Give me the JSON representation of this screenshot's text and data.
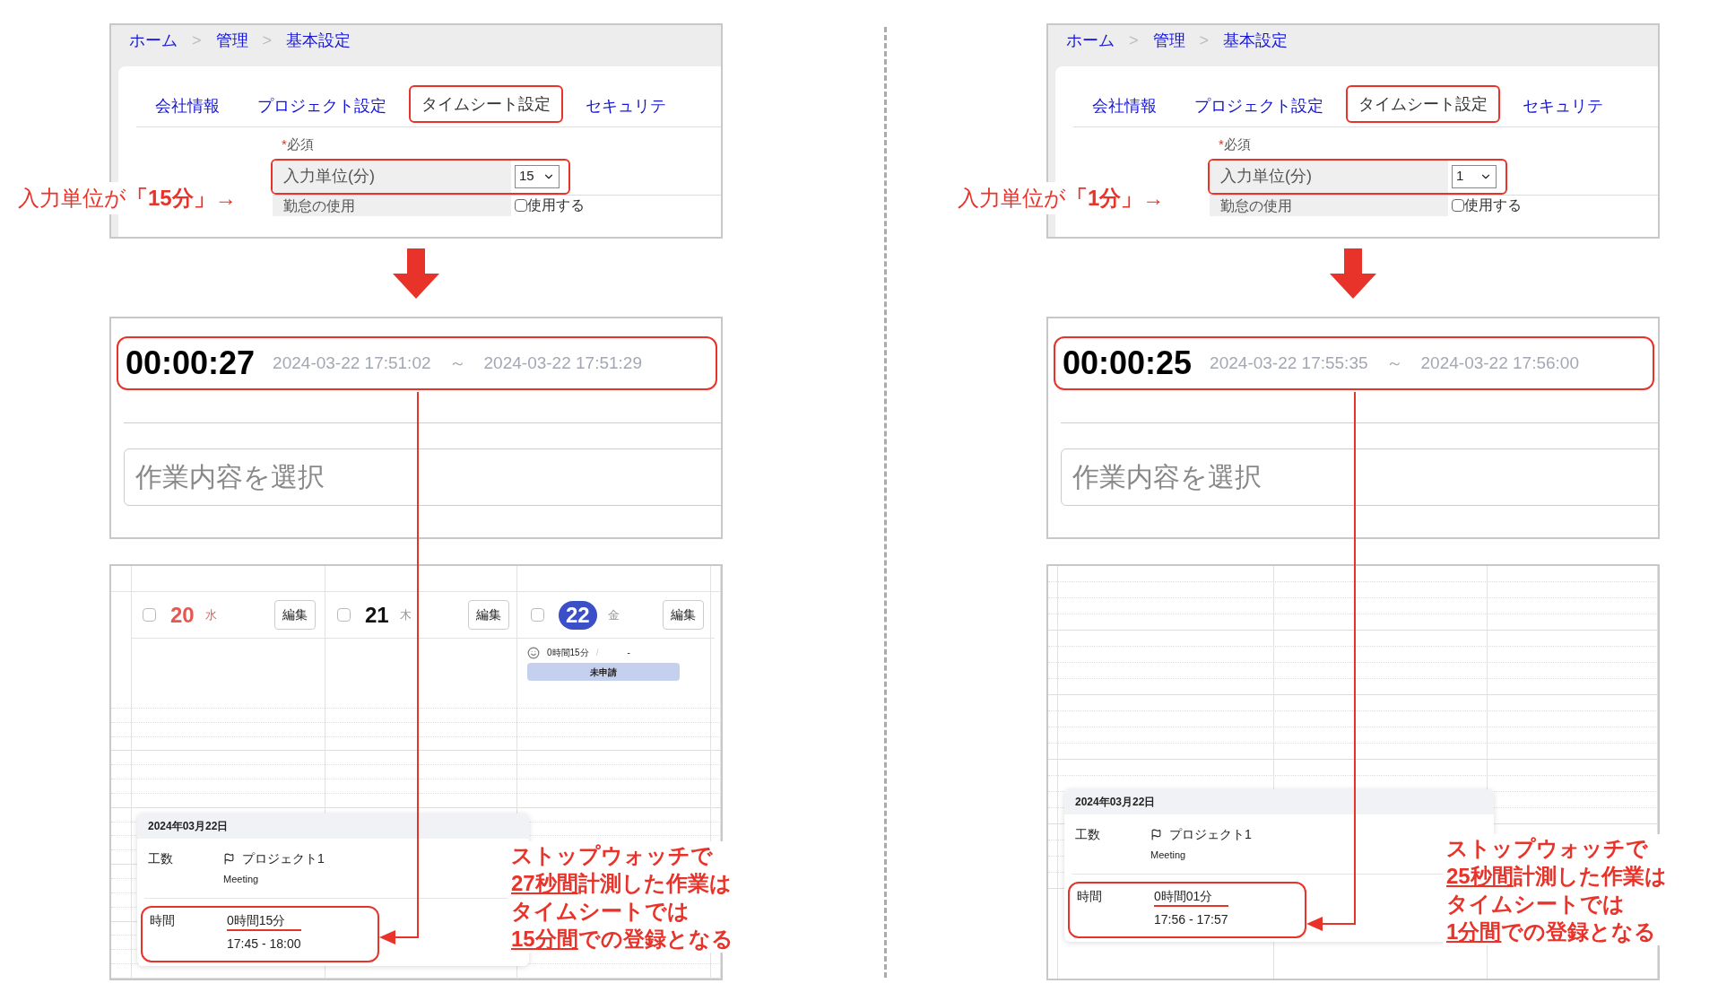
{
  "halves": [
    {
      "unit_note": "入力単位が**「15分」**→",
      "settings": {
        "breadcrumb": [
          {
            "label": "ホーム"
          },
          {
            "label": "管理"
          },
          {
            "label": "基本設定"
          }
        ],
        "breadcrumb_separator": ">",
        "tabs": [
          {
            "label": "会社情報",
            "selected": false
          },
          {
            "label": "プロジェクト設定",
            "selected": false
          },
          {
            "label": "タイムシート設定",
            "selected": true
          },
          {
            "label": "セキュリテ",
            "selected": false
          }
        ],
        "required_mark": "*",
        "required_label": "必須",
        "unit_field": {
          "label": "入力単位(分)",
          "value": "15"
        },
        "attendance": {
          "label": "勤怠の使用",
          "checkbox_label": "使用する",
          "checked": false
        }
      },
      "stopwatch": {
        "elapsed": "00:00:27",
        "start": "2024-03-22 17:51:02",
        "separator": "～",
        "end": "2024-03-22 17:51:29",
        "task_placeholder": "作業内容を選択"
      },
      "calendar": {
        "days": [
          {
            "day": "20",
            "weekday": "水",
            "holiday": true,
            "selected": false,
            "checked": false,
            "edit_label": "編集"
          },
          {
            "day": "21",
            "weekday": "木",
            "holiday": false,
            "selected": false,
            "checked": false,
            "edit_label": "編集"
          },
          {
            "day": "22",
            "weekday": "金",
            "holiday": false,
            "selected": true,
            "checked": false,
            "edit_label": "編集",
            "summary": {
              "hours": "0時間15分",
              "separator": "/",
              "value": "-",
              "status": "未申請"
            }
          }
        ],
        "popover": {
          "date": "2024年03月22日",
          "effort_label": "工数",
          "project": "プロジェクト1",
          "task": "Meeting",
          "time_label": "時間",
          "duration": "0時間15分",
          "range": "17:45 - 18:00"
        }
      },
      "note_lines": [
        [
          {
            "text": "ストップウォッチで",
            "underlined": false
          }
        ],
        [
          {
            "text": "27秒間",
            "underlined": true
          },
          {
            "text": "計測した作業は",
            "underlined": false
          }
        ],
        [
          {
            "text": "タイムシートでは",
            "underlined": false
          }
        ],
        [
          {
            "text": "15分間",
            "underlined": true
          },
          {
            "text": "での登録となる",
            "underlined": false
          }
        ]
      ]
    },
    {
      "unit_note": "入力単位が**「1分」**→",
      "settings": {
        "breadcrumb": [
          {
            "label": "ホーム"
          },
          {
            "label": "管理"
          },
          {
            "label": "基本設定"
          }
        ],
        "breadcrumb_separator": ">",
        "tabs": [
          {
            "label": "会社情報",
            "selected": false
          },
          {
            "label": "プロジェクト設定",
            "selected": false
          },
          {
            "label": "タイムシート設定",
            "selected": true
          },
          {
            "label": "セキュリテ",
            "selected": false
          }
        ],
        "required_mark": "*",
        "required_label": "必須",
        "unit_field": {
          "label": "入力単位(分)",
          "value": "1"
        },
        "attendance": {
          "label": "勤怠の使用",
          "checkbox_label": "使用する",
          "checked": false
        }
      },
      "stopwatch": {
        "elapsed": "00:00:25",
        "start": "2024-03-22 17:55:35",
        "separator": "～",
        "end": "2024-03-22 17:56:00",
        "task_placeholder": "作業内容を選択"
      },
      "calendar": {
        "popover": {
          "date": "2024年03月22日",
          "effort_label": "工数",
          "project": "プロジェクト1",
          "task": "Meeting",
          "time_label": "時間",
          "duration": "0時間01分",
          "range": "17:56 - 17:57"
        }
      },
      "note_lines": [
        [
          {
            "text": "ストップウォッチで",
            "underlined": false
          }
        ],
        [
          {
            "text": "25秒間",
            "underlined": true
          },
          {
            "text": "計測した作業は",
            "underlined": false
          }
        ],
        [
          {
            "text": "タイムシートでは",
            "underlined": false
          }
        ],
        [
          {
            "text": "1分間",
            "underlined": true
          },
          {
            "text": "での登録となる",
            "underlined": false
          }
        ]
      ]
    }
  ]
}
